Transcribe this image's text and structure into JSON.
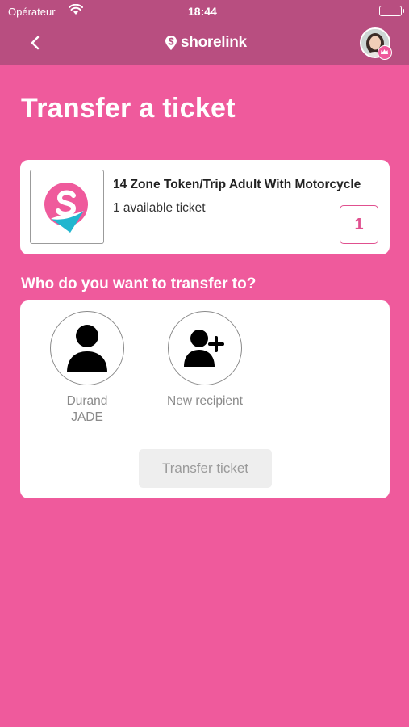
{
  "status_bar": {
    "carrier": "Opérateur",
    "time": "18:44"
  },
  "nav": {
    "brand_name": "shorelink",
    "back_icon": "chevron-left-icon",
    "avatar_badge_icon": "crown-icon"
  },
  "page": {
    "title": "Transfer a ticket"
  },
  "ticket": {
    "name": "14 Zone Token/Trip Adult With Motorcycle",
    "availability": "1 available ticket",
    "count": "1"
  },
  "transfer": {
    "heading": "Who do you want to transfer to?",
    "recipients": [
      {
        "first_name": "Durand",
        "last_name": "JADE",
        "icon": "person-icon"
      },
      {
        "label": "New recipient",
        "icon": "add-person-icon"
      }
    ],
    "button_label": "Transfer ticket"
  },
  "colors": {
    "background": "#ef5a9c",
    "header": "#b84e80",
    "accent": "#e0508f",
    "logo_teal": "#22b6cf"
  }
}
